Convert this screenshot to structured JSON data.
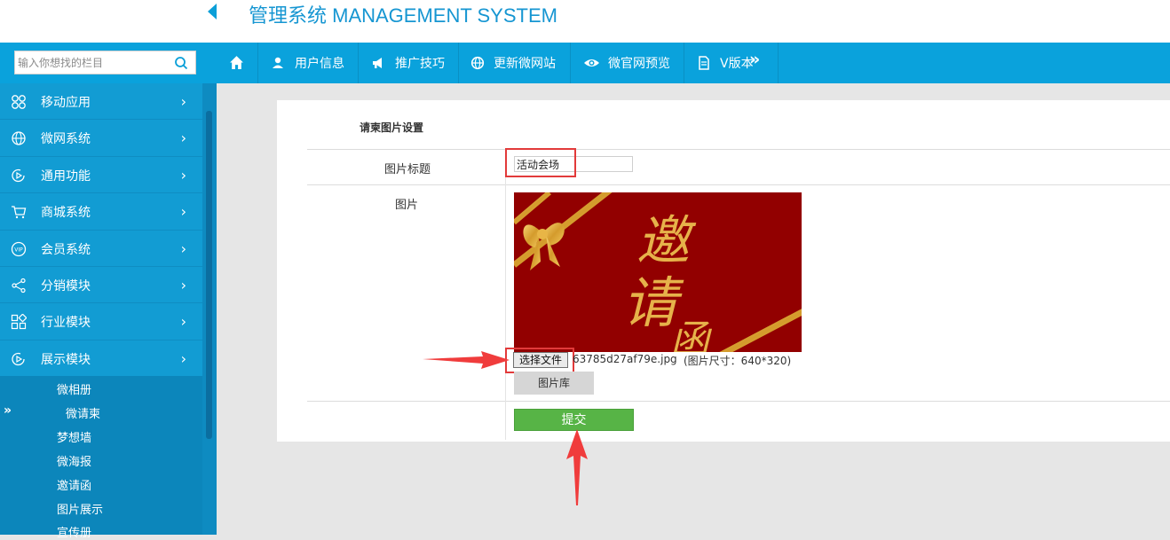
{
  "app": {
    "title": "管理系统 MANAGEMENT SYSTEM"
  },
  "sidebar": {
    "search": {
      "placeholder": "输入你想找的栏目"
    },
    "menu": [
      {
        "label": "移动应用",
        "icon": "apps-icon"
      },
      {
        "label": "微网系统",
        "icon": "globe-icon"
      },
      {
        "label": "通用功能",
        "icon": "play-circle-icon"
      },
      {
        "label": "商城系统",
        "icon": "cart-icon"
      },
      {
        "label": "会员系统",
        "icon": "vip-icon"
      },
      {
        "label": "分销模块",
        "icon": "share-icon"
      },
      {
        "label": "行业模块",
        "icon": "grid-icon"
      },
      {
        "label": "展示模块",
        "icon": "play-circle-icon"
      }
    ],
    "submenu": [
      "微相册",
      "微请柬",
      "梦想墙",
      "微海报",
      "邀请函",
      "图片展示",
      "宣传册"
    ],
    "active_submenu": "微请柬",
    "active_marker": "»"
  },
  "nav": {
    "home_icon": "home-icon",
    "items": [
      {
        "label": "用户信息",
        "icon": "user-icon"
      },
      {
        "label": "推广技巧",
        "icon": "megaphone-icon"
      },
      {
        "label": "更新微网站",
        "icon": "globe-icon"
      },
      {
        "label": "微官网预览",
        "icon": "eye-icon"
      },
      {
        "label": "V版本",
        "icon": "document-icon"
      }
    ],
    "more": "»"
  },
  "form": {
    "section_title": "请柬图片设置",
    "title_label": "图片标题",
    "title_value": "活动会场",
    "image_label": "图片",
    "choose_file_label": "选择文件",
    "file_name": "63785d27af79e.jpg",
    "image_size_text": "(图片尺寸：640*320)",
    "gallery_label": "图片库",
    "submit_label": "提交"
  },
  "preview_image": {
    "text_lines": [
      "邀",
      "请",
      "函"
    ],
    "background": "#920000",
    "accent": "#d9a63a"
  },
  "colors": {
    "sidebar": "#0e91c8",
    "navbar": "#0aa2dc",
    "submit": "#57b446",
    "annotation": "#e23a3a"
  }
}
